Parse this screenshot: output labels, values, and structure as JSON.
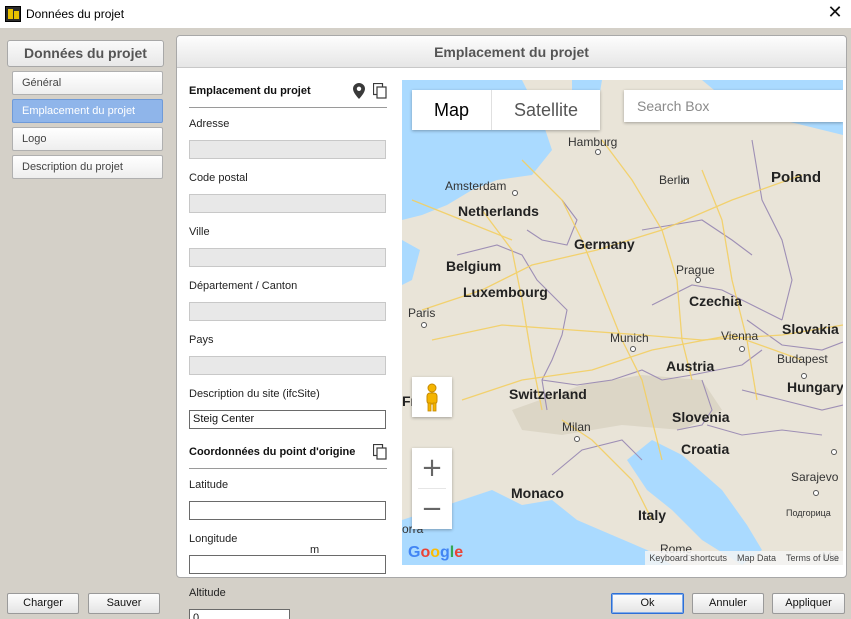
{
  "window": {
    "title": "Données du projet",
    "close_glyph": "✕"
  },
  "nav": {
    "header": "Données du projet",
    "items": [
      {
        "label": "Général",
        "active": false
      },
      {
        "label": "Emplacement du projet",
        "active": true
      },
      {
        "label": "Logo",
        "active": false
      },
      {
        "label": "Description du projet",
        "active": false
      }
    ]
  },
  "panel": {
    "title": "Emplacement du projet"
  },
  "location_section": {
    "title": "Emplacement du projet",
    "icons": [
      "map-pin-icon",
      "copy-icon"
    ],
    "fields": [
      {
        "label": "Adresse",
        "value": ""
      },
      {
        "label": "Code postal",
        "value": ""
      },
      {
        "label": "Ville",
        "value": ""
      },
      {
        "label": "Département / Canton",
        "value": ""
      },
      {
        "label": "Pays",
        "value": ""
      },
      {
        "label": "Description du site (ifcSite)",
        "value": "Steig Center"
      }
    ]
  },
  "origin_section": {
    "title": "Coordonnées du point d'origine",
    "icons": [
      "copy-icon"
    ],
    "latitude_label": "Latitude",
    "latitude_value": "",
    "longitude_label": "Longitude",
    "longitude_value": "",
    "altitude_label": "Altitude",
    "altitude_value": "0",
    "altitude_unit": "m"
  },
  "map": {
    "type_buttons": [
      "Map",
      "Satellite"
    ],
    "active_type": "Map",
    "search_placeholder": "Search Box",
    "zoom_in": "+",
    "zoom_out": "−",
    "logo": "Google",
    "attribution": [
      "Keyboard shortcuts",
      "Map Data",
      "Terms of Use"
    ],
    "countries": [
      "Netherlands",
      "Belgium",
      "Luxembourg",
      "Germany",
      "Poland",
      "Czechia",
      "Slovakia",
      "Austria",
      "Hungary",
      "Switzerland",
      "Slovenia",
      "Croatia",
      "Monaco",
      "Italy"
    ],
    "cities": [
      "Hamburg",
      "Berlin",
      "Amsterdam",
      "Prague",
      "Paris",
      "Munich",
      "Vienna",
      "Budapest",
      "Milan",
      "Sarajevo",
      "Rome",
      "Подгорица"
    ],
    "partial_labels": [
      "Fr",
      "orra",
      "Ma",
      "Подгорица"
    ],
    "colors": {
      "land": "#e9e4d8",
      "water": "#aadaff",
      "border": "#9e8fb5",
      "road": "#f3cf63"
    }
  },
  "buttons": {
    "load": "Charger",
    "save": "Sauver",
    "ok": "Ok",
    "cancel": "Annuler",
    "apply": "Appliquer"
  }
}
